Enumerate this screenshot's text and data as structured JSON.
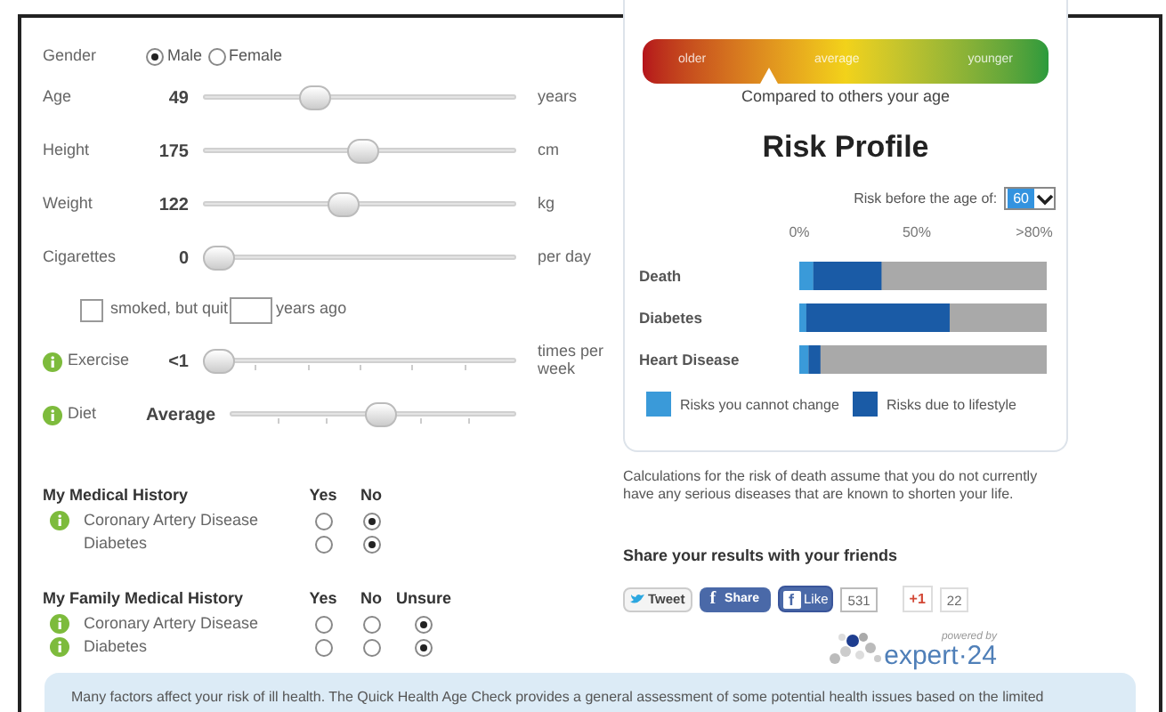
{
  "profile": {
    "gender": {
      "label": "Gender",
      "options": [
        {
          "label": "Male",
          "selected": true
        },
        {
          "label": "Female",
          "selected": false
        }
      ]
    },
    "sliders": [
      {
        "kind": "plain",
        "label": "Age",
        "info": false,
        "value": "49",
        "level": 0.34,
        "unit": "years"
      },
      {
        "kind": "plain",
        "label": "Height",
        "info": false,
        "value": "175",
        "level": 0.51,
        "unit": "cm"
      },
      {
        "kind": "plain",
        "label": "Weight",
        "info": false,
        "value": "122",
        "level": 0.44,
        "unit": "kg"
      },
      {
        "kind": "plain",
        "label": "Cigarettes",
        "info": false,
        "value": "0",
        "level": 0,
        "unit": "per day"
      },
      {
        "kind": "quit",
        "checked": false,
        "before": "smoked, but quit",
        "after": "years ago"
      },
      {
        "kind": "stepped",
        "label": "Exercise",
        "info": true,
        "value": "<1",
        "level": 0,
        "unit": "times per week"
      },
      {
        "kind": "stepped",
        "label": "Diet",
        "info": true,
        "value": "Average",
        "level": 0.53
      }
    ]
  },
  "histories": [
    {
      "title": "My Medical History",
      "columns": [
        "Yes",
        "No"
      ],
      "rows": [
        {
          "label": "Coronary Artery Disease",
          "info": true,
          "options": [
            {
              "selected": false
            },
            {
              "selected": true
            }
          ]
        },
        {
          "label": "Diabetes",
          "info": false,
          "options": [
            {
              "selected": false
            },
            {
              "selected": true
            }
          ]
        }
      ]
    },
    {
      "title": "My Family Medical History",
      "columns": [
        "Yes",
        "No",
        "Unsure"
      ],
      "rows": [
        {
          "label": "Coronary Artery Disease",
          "info": true,
          "options": [
            {
              "selected": false
            },
            {
              "selected": false
            },
            {
              "selected": true
            }
          ]
        },
        {
          "label": "Diabetes",
          "info": true,
          "options": [
            {
              "selected": false
            },
            {
              "selected": false
            },
            {
              "selected": true
            }
          ]
        }
      ]
    }
  ],
  "risk_panel": {
    "gauge": {
      "labels": [
        "older",
        "average",
        "younger"
      ],
      "caption": "Compared to others your age"
    },
    "title": "Risk Profile",
    "age_select": {
      "label": "Risk before the age of:",
      "value": "60"
    },
    "chart_data": {
      "type": "bar",
      "orientation": "horizontal",
      "stacked": true,
      "categories": [
        "Death",
        "Diabetes",
        "Heart Disease"
      ],
      "legend": "bottom",
      "xlim": [
        0,
        1
      ],
      "xticks": [
        {
          "value": 0,
          "label": "0%"
        },
        {
          "value": 0.5,
          "label": "50%"
        },
        {
          "value": 1,
          "label": ">80%"
        }
      ],
      "series": [
        {
          "name": "Risks you cannot change",
          "color": "#3a9ad9",
          "values": [
            0.06,
            0.03,
            0.04
          ]
        },
        {
          "name": "Risks due to lifestyle",
          "color": "#1a5ba6",
          "values": [
            0.29,
            0.61,
            0.05
          ]
        }
      ]
    }
  },
  "note": "Calculations for the risk of death assume that you do not currently have any serious diseases that are known to shorten your life.",
  "share": {
    "title": "Share your results with your friends",
    "buttons": [
      {
        "kind": "tweet",
        "label": "Tweet"
      },
      {
        "kind": "share",
        "icon": "f",
        "label": "Share"
      },
      {
        "kind": "like",
        "icon": "f",
        "label": "Like",
        "count": "531"
      },
      {
        "kind": "plusone",
        "label": "+1",
        "count": "22"
      }
    ]
  },
  "powered": {
    "caption": "powered by",
    "brand": "expert·24"
  },
  "info_box": "Many factors affect your risk of ill health. The Quick Health Age Check provides a general assessment of some potential health issues based on the limited"
}
